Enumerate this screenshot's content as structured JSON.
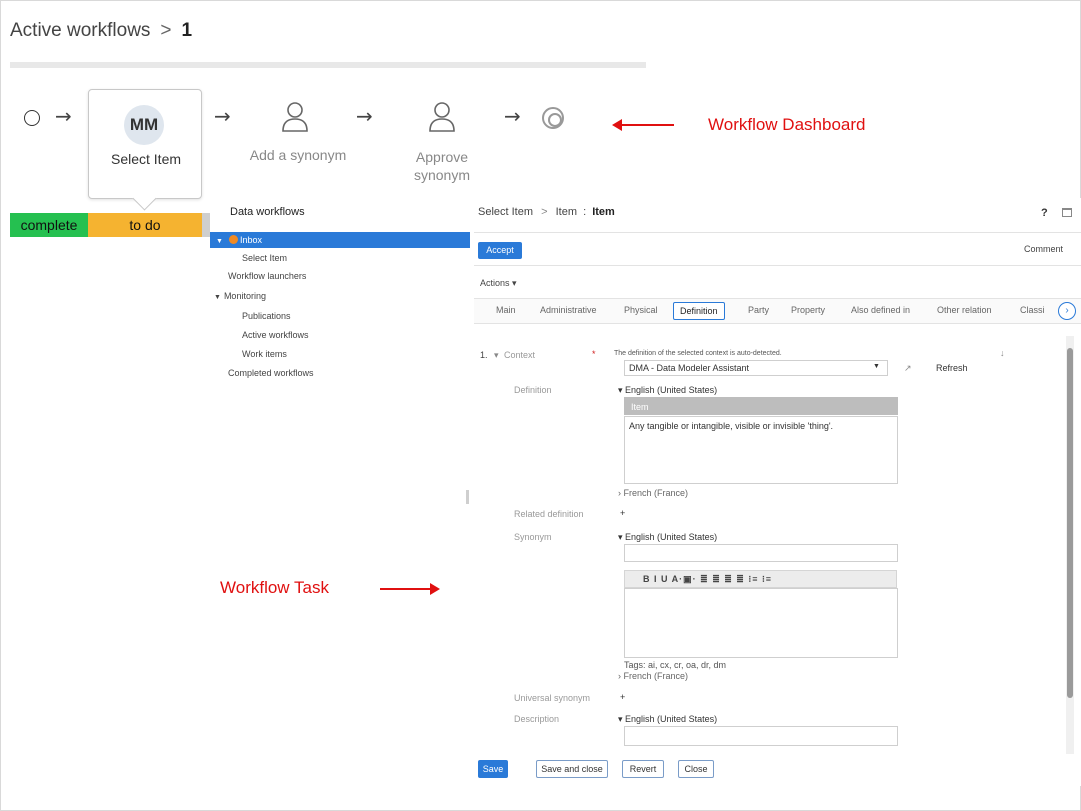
{
  "breadcrumb": {
    "title": "Active workflows",
    "separator": ">",
    "current": "1"
  },
  "workflow": {
    "steps": [
      {
        "avatar": "MM",
        "label": "Select Item"
      },
      {
        "label": "Add a synonym"
      },
      {
        "label_line1": "Approve",
        "label_line2": "synonym"
      }
    ],
    "status": {
      "complete": "complete",
      "todo": "to do"
    },
    "colors": {
      "complete": "#25c050",
      "todo": "#f5b330",
      "accent": "#2a7ad8",
      "annotation": "#e01010"
    }
  },
  "annotations": {
    "dashboard": "Workflow Dashboard",
    "task": "Workflow Task"
  },
  "nav": {
    "title": "Data workflows",
    "items": {
      "inbox": "Inbox",
      "select_item": "Select Item",
      "launchers": "Workflow launchers",
      "monitoring": "Monitoring",
      "publications": "Publications",
      "active": "Active workflows",
      "work_items": "Work items",
      "completed": "Completed workflows"
    }
  },
  "panel": {
    "crumb": {
      "part1": "Select Item",
      "sep": ">",
      "part2": "Item",
      "colon": ":",
      "part3": "Item"
    },
    "help": "?",
    "accept": "Accept",
    "comment": "Comment",
    "actions": "Actions ▾",
    "tabs": [
      "Main",
      "Administrative",
      "Physical",
      "Definition",
      "Party",
      "Property",
      "Also defined in",
      "Other relation",
      "Classi"
    ],
    "active_tab": "Definition",
    "form": {
      "index": "1.",
      "context_label": "Context",
      "context_note": "The definition of the selected context is auto-detected.",
      "context_value": "DMA - Data Modeler Assistant",
      "refresh": "Refresh",
      "definition_label": "Definition",
      "lang_en": "English (United States)",
      "lang_fr": "French (France)",
      "def_header": "Item",
      "def_text": "Any tangible or intangible, visible or invisible 'thing'.",
      "related_label": "Related definition",
      "synonym_label": "Synonym",
      "toolbar": "B I U A·▣·  ≣ ≣ ≣ ≣  ⁝≡ ⁝≡",
      "tags": "Tags: ai, cx, cr, oa, dr, dm",
      "universal_label": "Universal synonym",
      "description_label": "Description",
      "plus": "+"
    },
    "buttons": {
      "save": "Save",
      "save_close": "Save and close",
      "revert": "Revert",
      "close": "Close"
    }
  }
}
